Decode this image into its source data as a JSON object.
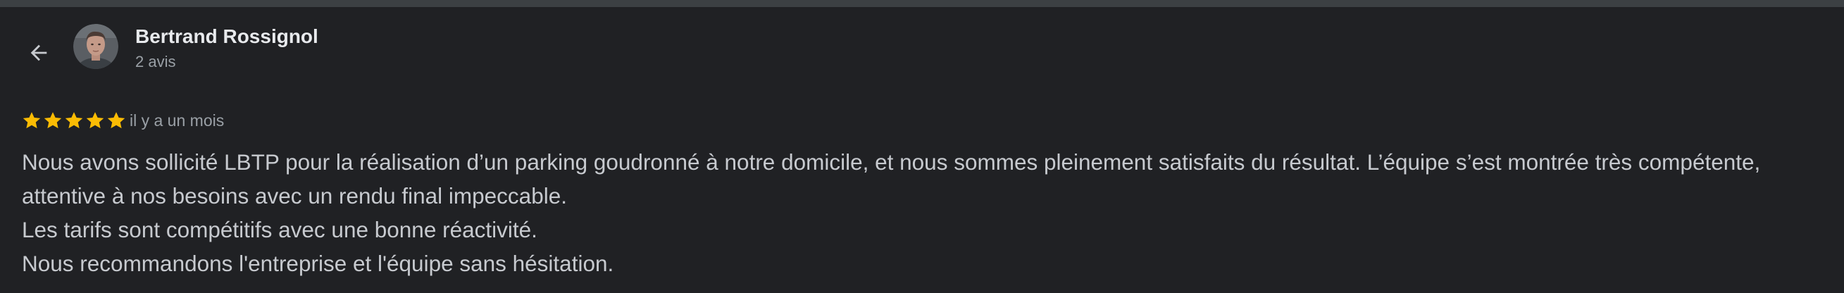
{
  "review": {
    "author_name": "Bertrand Rossignol",
    "review_count": "2 avis",
    "rating": 5,
    "rating_max": 5,
    "time": "il y a un mois",
    "paragraphs": [
      "Nous avons sollicité LBTP pour la réalisation d’un parking goudronné à notre domicile, et nous sommes pleinement satisfaits du résultat. L’équipe s’est montrée très compétente, attentive à nos besoins avec un rendu final impeccable.",
      "Les tarifs sont compétitifs avec une bonne réactivité.",
      "Nous recommandons l'entreprise et l'équipe sans hésitation."
    ]
  },
  "icons": {
    "back": "arrow-left-icon",
    "star": "star-icon"
  },
  "colors": {
    "background": "#202124",
    "star": "#fbbc04",
    "name": "#e8eaed",
    "secondary": "#9aa0a6",
    "body": "#c7cacf"
  }
}
